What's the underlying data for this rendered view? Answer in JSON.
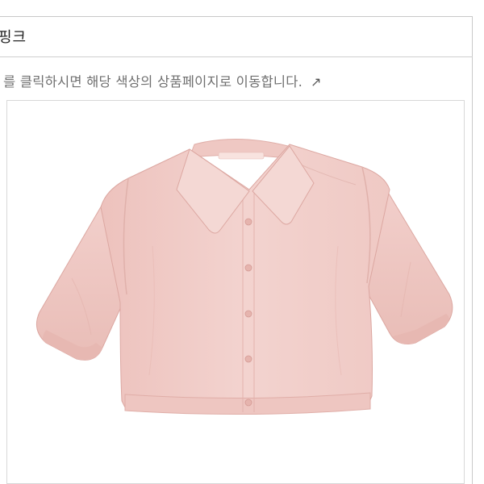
{
  "option": {
    "color_name": "핑크"
  },
  "notice": {
    "text": "를 클릭하시면 해당 색상의 상품페이지로 이동합니다.",
    "arrow_icon": "arrow-up-right-icon"
  },
  "product_image": {
    "subject": "short-sleeve pink shirt",
    "shirt_color": "#F2CFCB"
  }
}
